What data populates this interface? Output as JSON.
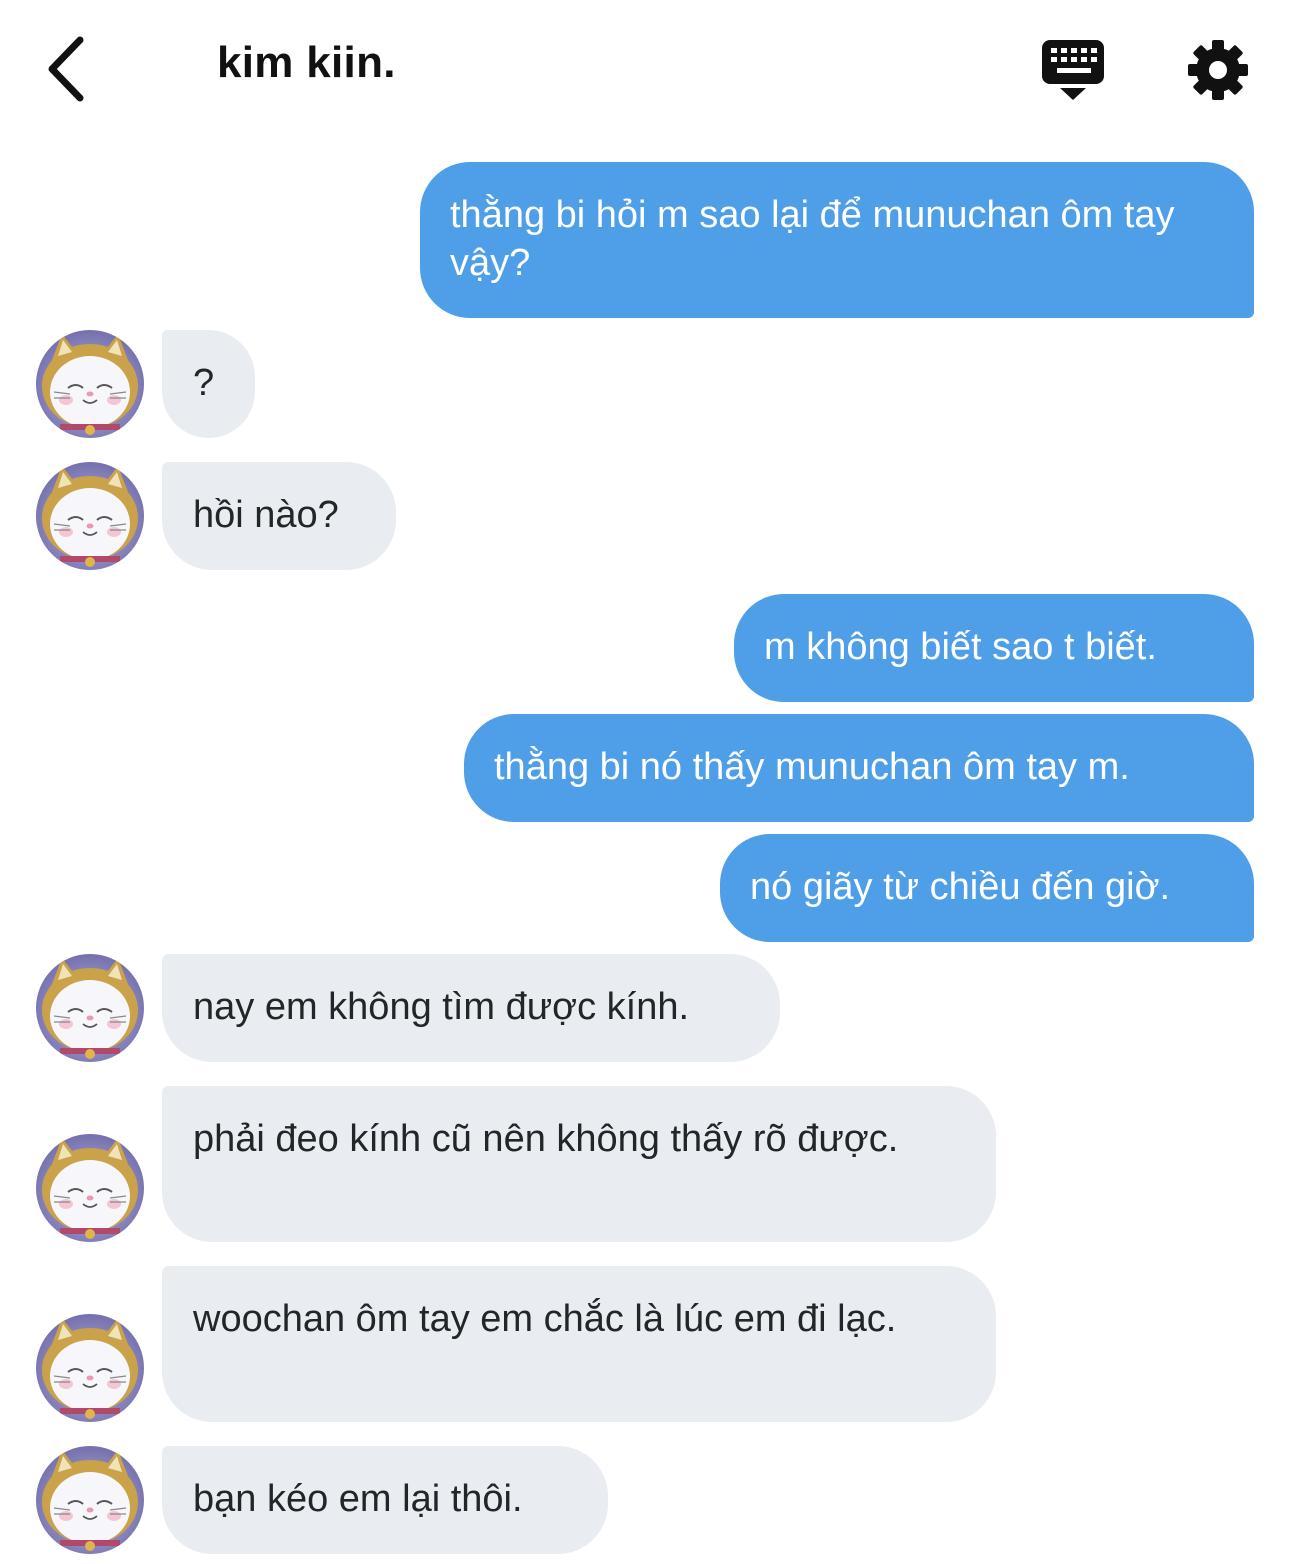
{
  "header": {
    "title": "kim kiin.",
    "back_icon": "chevron-left-icon",
    "keyboard_icon": "keyboard-dismiss-icon",
    "settings_icon": "gear-icon"
  },
  "colors": {
    "outgoing_bubble": "#4e9ee8",
    "incoming_bubble": "#e9edf1",
    "outgoing_text": "#ffffff",
    "incoming_text": "#232629"
  },
  "messages": [
    {
      "from": "me",
      "text": "thằng bi hỏi m sao lại để munuchan ôm tay vậy?"
    },
    {
      "from": "them",
      "text": "?"
    },
    {
      "from": "them",
      "text": "hồi nào?"
    },
    {
      "from": "me",
      "text": "m không biết sao t biết."
    },
    {
      "from": "me",
      "text": "thằng bi nó thấy munuchan ôm tay m."
    },
    {
      "from": "me",
      "text": "nó giãy từ chiều đến giờ."
    },
    {
      "from": "them",
      "text": "nay em không tìm được kính."
    },
    {
      "from": "them",
      "text": "phải đeo kính cũ nên không thấy rõ được."
    },
    {
      "from": "them",
      "text": "woochan ôm tay em chắc là lúc em đi lạc."
    },
    {
      "from": "them",
      "text": "bạn kéo em lại thôi."
    }
  ]
}
